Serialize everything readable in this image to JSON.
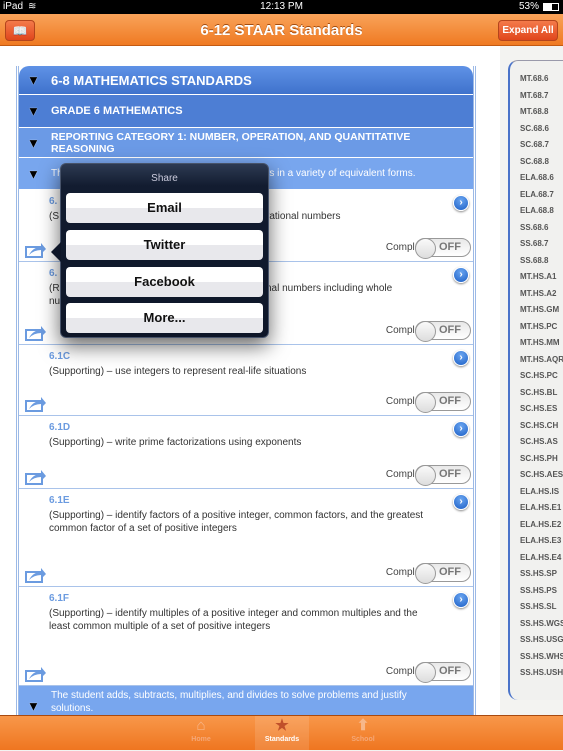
{
  "status_bar": {
    "device": "iPad",
    "time": "12:13 PM",
    "battery": "53%"
  },
  "nav": {
    "title": "6-12 STAAR Standards",
    "expand_all": "Expand All",
    "book_icon": "book-icon"
  },
  "headers": [
    {
      "label": "6-8 MATHEMATICS STANDARDS",
      "color": "#4a7fd6"
    },
    {
      "label": "GRADE 6 MATHEMATICS",
      "color": "#4d7ed4"
    },
    {
      "label": "REPORTING CATEGORY 1: NUMBER, OPERATION, AND QUANTITATIVE REASONING",
      "color": "#6b9ae6"
    }
  ],
  "knowledge_row": {
    "left": "Th",
    "right": "rs in a variety of equivalent forms."
  },
  "items": [
    {
      "code": "6.",
      "desc_left": "(S",
      "desc_right": "rational numbers"
    },
    {
      "code": "6.",
      "desc_left": "(R",
      "desc_left2": "nu",
      "desc_right": "nal numbers including whole"
    },
    {
      "code": "6.1C",
      "desc": "(Supporting) – use integers to represent real-life situations"
    },
    {
      "code": "6.1D",
      "desc": "(Supporting) – write prime factorizations using exponents"
    },
    {
      "code": "6.1E",
      "desc": "(Supporting) – identify factors of a positive integer, common factors, and the greatest common factor of a set of positive integers"
    },
    {
      "code": "6.1F",
      "desc": "(Supporting) – identify multiples of a positive integer and common multiples and the least common multiple of a set of positive integers"
    }
  ],
  "completed_label": "Completed:",
  "toggle_off": "OFF",
  "footer_row": "The student adds, subtracts, multiplies, and divides to solve problems and justify solutions.",
  "share_popover": {
    "title": "Share",
    "options": [
      "Email",
      "Twitter",
      "Facebook",
      "More..."
    ]
  },
  "sidebar": [
    "MT.68.6",
    "MT.68.7",
    "MT.68.8",
    "SC.68.6",
    "SC.68.7",
    "SC.68.8",
    "ELA.68.6",
    "ELA.68.7",
    "ELA.68.8",
    "SS.68.6",
    "SS.68.7",
    "SS.68.8",
    "MT.HS.A1",
    "MT.HS.A2",
    "MT.HS.GM",
    "MT.HS.PC",
    "MT.HS.MM",
    "MT.HS.AQR",
    "SC.HS.PC",
    "SC.HS.BL",
    "SC.HS.ES",
    "SC.HS.CH",
    "SC.HS.AS",
    "SC.HS.PH",
    "SC.HS.AES",
    "ELA.HS.IS",
    "ELA.HS.E1",
    "ELA.HS.E2",
    "ELA.HS.E3",
    "ELA.HS.E4",
    "SS.HS.SP",
    "SS.HS.PS",
    "SS.HS.SL",
    "SS.HS.WGS",
    "SS.HS.USG",
    "SS.HS.WHS",
    "SS.HS.USH"
  ],
  "tabs": [
    {
      "label": "Home",
      "icon": "home-icon"
    },
    {
      "label": "Standards",
      "icon": "star-icon",
      "active": true
    },
    {
      "label": "School",
      "icon": "school-icon"
    }
  ],
  "colors": {
    "accent": "#ef7a22",
    "header_dark": "#4a7fd6",
    "header_light": "#6b9ae6",
    "code": "#6b9be0"
  }
}
